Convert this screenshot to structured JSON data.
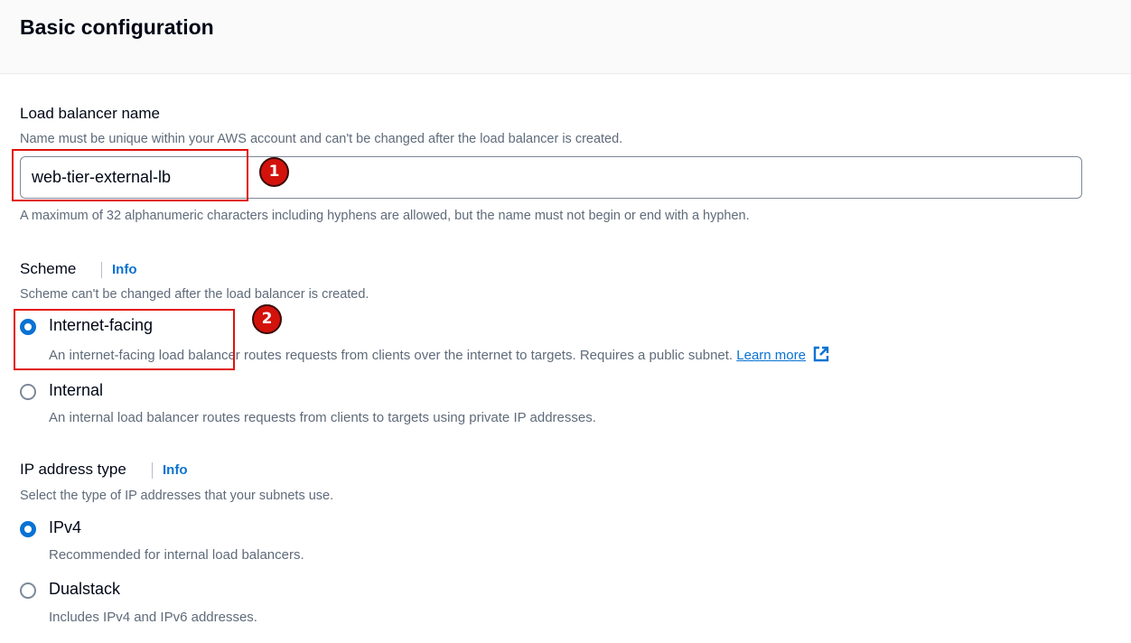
{
  "section": {
    "title": "Basic configuration"
  },
  "load_balancer_name": {
    "label": "Load balancer name",
    "description": "Name must be unique within your AWS account and can't be changed after the load balancer is created.",
    "value": "web-tier-external-lb",
    "constraint": "A maximum of 32 alphanumeric characters including hyphens are allowed, but the name must not begin or end with a hyphen."
  },
  "scheme": {
    "label": "Scheme",
    "info": "Info",
    "description": "Scheme can't be changed after the load balancer is created.",
    "options": [
      {
        "label": "Internet-facing",
        "description": "An internet-facing load balancer routes requests from clients over the internet to targets. Requires a public subnet.",
        "link": "Learn more",
        "selected": true
      },
      {
        "label": "Internal",
        "description": "An internal load balancer routes requests from clients to targets using private IP addresses.",
        "selected": false
      }
    ]
  },
  "ip_address_type": {
    "label": "IP address type",
    "info": "Info",
    "description": "Select the type of IP addresses that your subnets use.",
    "options": [
      {
        "label": "IPv4",
        "description": "Recommended for internal load balancers.",
        "selected": true
      },
      {
        "label": "Dualstack",
        "description": "Includes IPv4 and IPv6 addresses.",
        "selected": false
      }
    ]
  },
  "annotations": [
    {
      "number": "1"
    },
    {
      "number": "2"
    }
  ],
  "colors": {
    "accent": "#0972d3",
    "annotation": "#d3120c",
    "secondary_text": "#5f6b7a"
  }
}
